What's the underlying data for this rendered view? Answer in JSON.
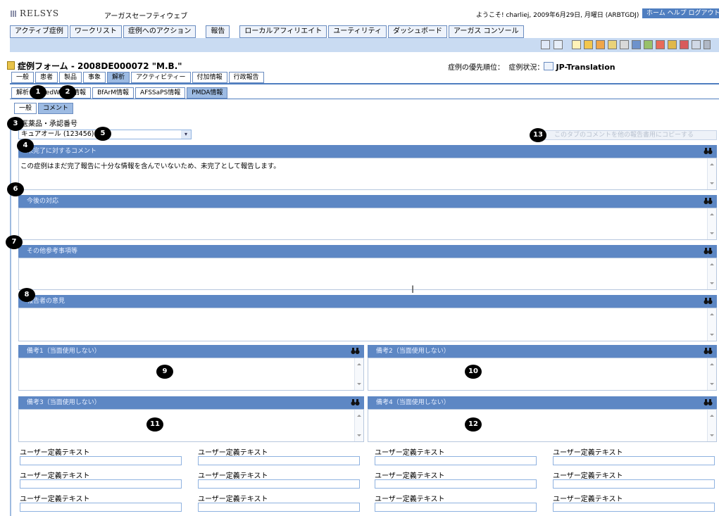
{
  "header": {
    "logo": "RELSYS",
    "app_title": "アーガスセーフティウェブ",
    "welcome": "ようこそ! charliej, 2009年6月29日, 月曜日 (ARBTGDJ)",
    "links": "ホーム  ヘルプ  ログアウト"
  },
  "menu": [
    "アクティブ症例",
    "ワークリスト",
    "症例へのアクション",
    "報告",
    "ローカルアフィリエイト",
    "ユーティリティ",
    "ダッシュボード",
    "アーガス コンソール"
  ],
  "form": {
    "title": "症例フォーム - 2008DE000072 \"M.B.\"",
    "priority_label": "症例の優先順位：",
    "status_label": "症例状況：",
    "status_value": "JP-Translation"
  },
  "main_tabs": [
    "一般",
    "患者",
    "製品",
    "事象",
    "解析",
    "アクティビティー",
    "付加情報",
    "行政報告"
  ],
  "sub_tabs": [
    "解析",
    "MedWatch情報",
    "BfArM情報",
    "AFSSaPS情報",
    "PMDA情報"
  ],
  "inner_tabs": [
    "一般",
    "コメント"
  ],
  "product": {
    "label": "医薬品・承認番号",
    "selected": "キュアオール (123456)",
    "copy_button": "このタブのコメントを他の報告書用にコピーする"
  },
  "sections": {
    "incomplete_comment": {
      "title": "未完了に対するコメント",
      "value": "この症例はまだ完了報告に十分な情報を含んでいないため、未完了として報告します。"
    },
    "future_action": {
      "title": "今後の対応",
      "value": ""
    },
    "other_reference": {
      "title": "その他参考事項等",
      "value": ""
    },
    "reporter_opinion": {
      "title": "報告者の意見",
      "value": ""
    },
    "remark1": {
      "title": "備考1（当面使用しない）"
    },
    "remark2": {
      "title": "備考2（当面使用しない）"
    },
    "remark3": {
      "title": "備考3（当面使用しない）"
    },
    "remark4": {
      "title": "備考4（当面使用しない）"
    }
  },
  "udf_label": "ユーザー定義テキスト",
  "badges": [
    "1",
    "2",
    "3",
    "4",
    "5",
    "6",
    "7",
    "8",
    "9",
    "10",
    "11",
    "12",
    "13"
  ],
  "colors": {
    "section_bar": "#5d87c4",
    "tab_active": "#9dbbe3",
    "toolbar": "#c9dbf2"
  }
}
